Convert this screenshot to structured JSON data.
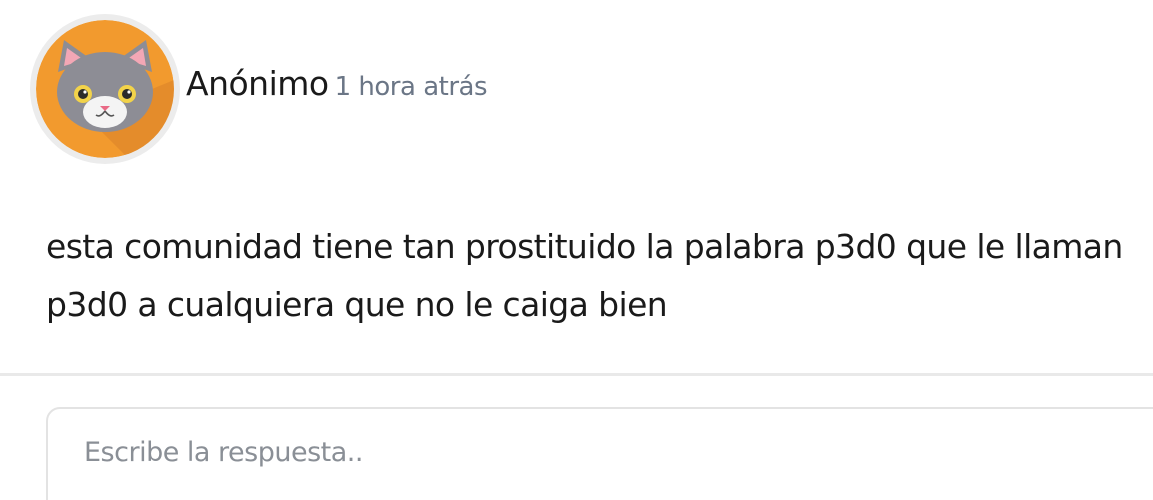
{
  "post": {
    "author": "Anónimo",
    "time": "1 hora atrás",
    "avatar_icon": "cat-avatar-icon",
    "avatar_bg": "#f29a2e",
    "text": "esta comunidad tiene tan prostituido la palabra p3d0 que le llaman p3d0 a cualquiera que no le caiga bien"
  },
  "reply": {
    "placeholder": "Escribe la respuesta.."
  }
}
